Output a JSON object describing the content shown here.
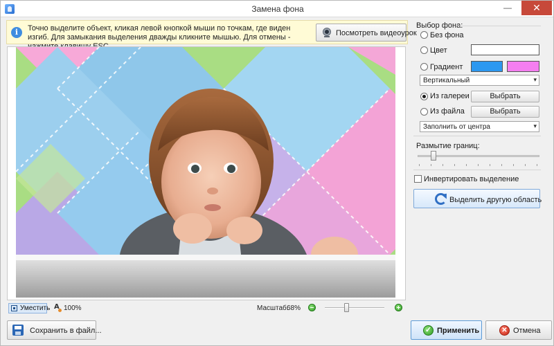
{
  "window": {
    "title": "Замена фона",
    "minimize_glyph": "—",
    "close_glyph": "✕"
  },
  "info": {
    "icon_glyph": "i",
    "text": "Точно выделите объект, кликая левой кнопкой мыши по точкам, где виден изгиб. Для замыкания выделения дважды кликните мышью. Для отмены - нажмите клавишу ESC.",
    "video_button": "Посмотреть видеоурок"
  },
  "status": {
    "fit_label": "Уместить",
    "zoom_percent": "100%",
    "scale_label": "Масштаб:",
    "scale_value": "68%",
    "scale_slider_fraction": 0.35
  },
  "bottom": {
    "save_label": "Сохранить в файл...",
    "apply_label": "Применить",
    "apply_glyph": "✓",
    "cancel_label": "Отмена",
    "cancel_glyph": "✕"
  },
  "panel": {
    "bg_title": "Выбор фона:",
    "options": {
      "none": "Без фона",
      "color": "Цвет",
      "gradient": "Градиент",
      "gallery": "Из галереи",
      "file": "Из файла"
    },
    "selected_option": "gallery",
    "color_value": "#ffffff",
    "gradient_colors": [
      "#2c98f0",
      "#f57ef0"
    ],
    "gradient_direction": "Вертикальный",
    "choose_label": "Выбрать",
    "fill_mode": "Заполнить от центра",
    "select_arrow": "▾",
    "blur_label": "Размытие границ:",
    "blur_fraction": 0.1,
    "invert_label": "Инвертировать выделение",
    "invert_checked": false,
    "other_region_label": "Выделить другую область"
  }
}
